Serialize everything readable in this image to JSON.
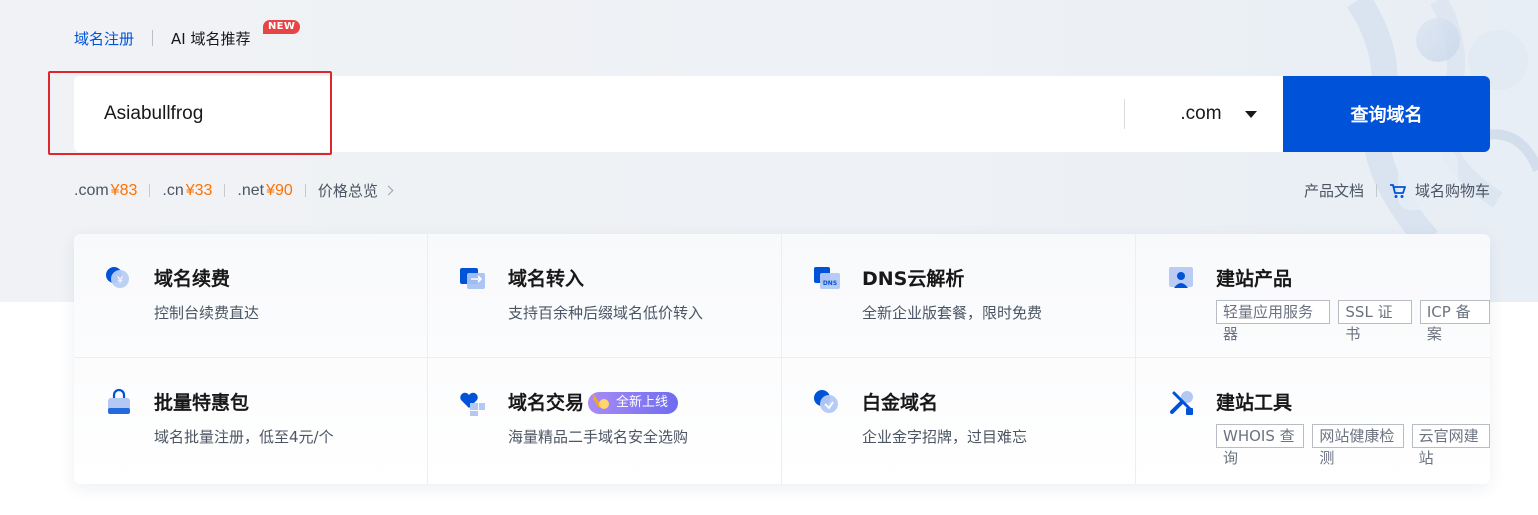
{
  "tabs": [
    {
      "label": "域名注册",
      "active": true
    },
    {
      "label": "AI 域名推荐",
      "badge": "NEW"
    }
  ],
  "search": {
    "value": "Asiabullfrog",
    "suffix": ".com",
    "button_label": "查询域名"
  },
  "prices": [
    {
      "tld": ".com",
      "price": "¥83"
    },
    {
      "tld": ".cn",
      "price": "¥33"
    },
    {
      "tld": ".net",
      "price": "¥90"
    }
  ],
  "price_overview_label": "价格总览",
  "right_links": {
    "docs": "产品文档",
    "cart": "域名购物车"
  },
  "colors": {
    "brand": "#0052d9",
    "price": "#ff7200",
    "new_badge": "#e54545",
    "highlight": "#e0262d"
  },
  "cards": [
    {
      "title": "域名续费",
      "desc": "控制台续费直达",
      "icon": "renew-coin-icon"
    },
    {
      "title": "域名转入",
      "desc": "支持百余种后缀域名低价转入",
      "icon": "transfer-icon"
    },
    {
      "title": "DNS云解析",
      "desc": "全新企业版套餐，限时免费",
      "icon": "dns-icon"
    },
    {
      "title": "建站产品",
      "tags": [
        "轻量应用服务器",
        "SSL 证书",
        "ICP 备案"
      ],
      "icon": "site-product-icon"
    },
    {
      "title": "批量特惠包",
      "desc": "域名批量注册，低至4元/个",
      "icon": "bag-icon"
    },
    {
      "title": "域名交易",
      "badge": "全新上线",
      "desc": "海量精品二手域名安全选购",
      "icon": "heart-trade-icon"
    },
    {
      "title": "白金域名",
      "desc": "企业金字招牌，过目难忘",
      "icon": "platinum-shield-icon"
    },
    {
      "title": "建站工具",
      "tags": [
        "WHOIS 查询",
        "网站健康检测",
        "云官网建站"
      ],
      "icon": "tools-icon"
    }
  ]
}
